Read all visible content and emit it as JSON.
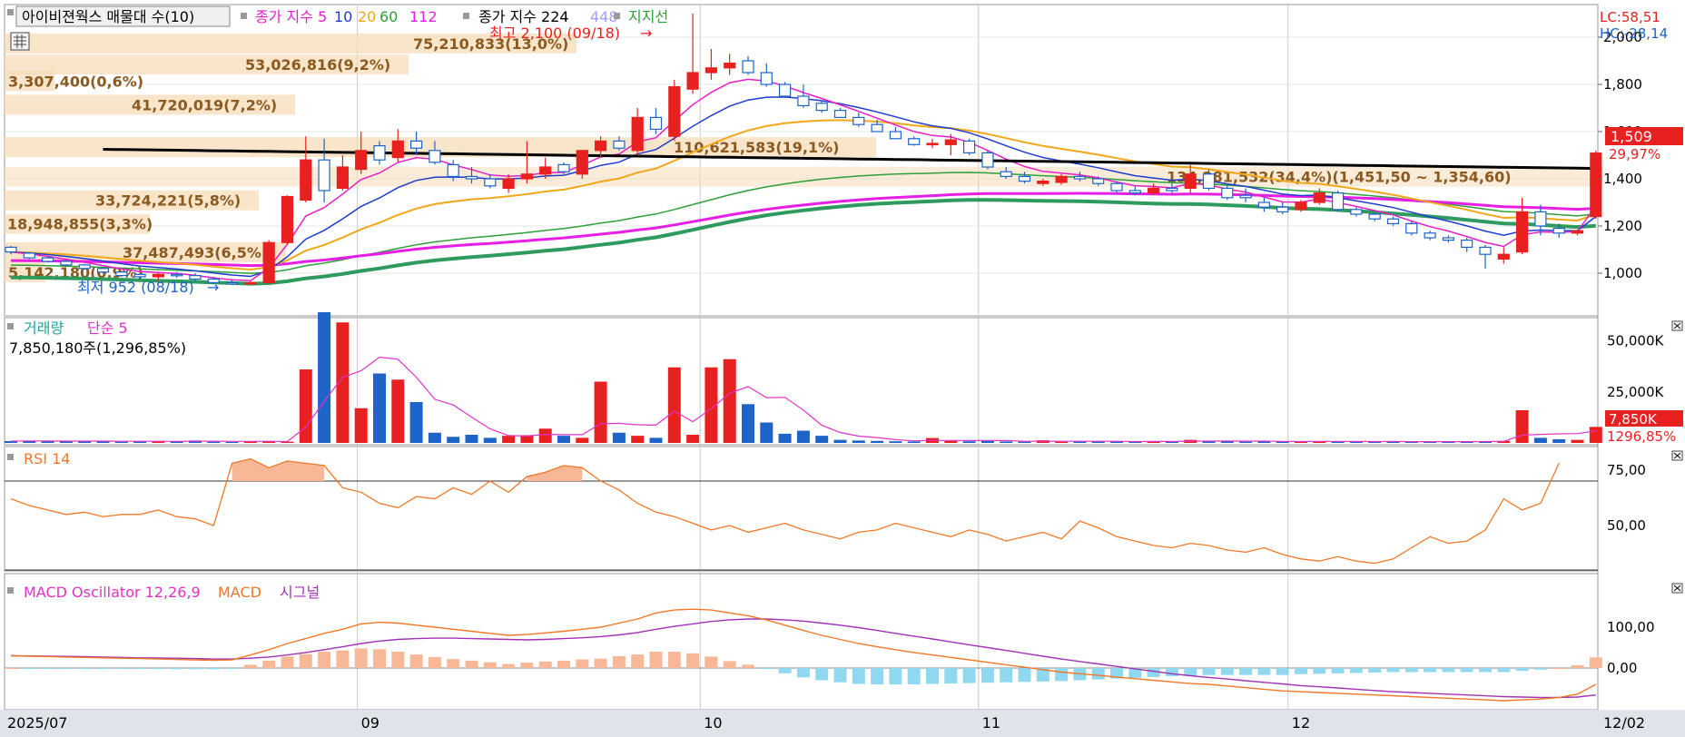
{
  "colors": {
    "up": "#e8201f",
    "down": "#1e63c8",
    "ma5": "#e61ec8",
    "ma10": "#1e3ccd",
    "ma20": "#f0a81a",
    "ma60": "#2ea03a",
    "ma112": "#e61ee6",
    "ma224": "#000000",
    "ma448": "#2f9a5e",
    "vol_ma": "#e032c8",
    "rsi": "#f07828",
    "macd": "#f07828",
    "signal": "#a032b4",
    "osc_pos": "#f8b898",
    "osc_neg": "#8fd8f0",
    "profile": "#f5dcb8",
    "profile_text": "#8a5a20",
    "grid": "#c8c8c8"
  },
  "header": {
    "title": "아이비젼웍스 매물대 수(10)",
    "ma_label": "종가 지수",
    "ma_periods": [
      "5",
      "10",
      "20",
      "60",
      "112"
    ],
    "ma_long_label": "종가 지수 224",
    "ma_long_extra": "448",
    "support_label": "지지선"
  },
  "price_panel": {
    "lc": "LC:58,51",
    "hc": "HC:-28,14",
    "axis_ticks": [
      "2,000",
      "1,800",
      "1,600",
      "1,400",
      "1,200",
      "1,000"
    ],
    "current_price": "1,509",
    "current_change": "29,97%",
    "high_label": "최고 2,100 (09/18)",
    "low_label": "최저 952 (08/18)",
    "volume_profile": [
      {
        "label": "75,210,833(13,0%)",
        "price": 1970
      },
      {
        "label": "53,026,816(9,2%)",
        "price": 1880
      },
      {
        "label": "3,307,400(0,6%)",
        "price": 1810
      },
      {
        "label": "41,720,019(7,2%)",
        "price": 1710
      },
      {
        "label": "110,621,583(19,1%)",
        "price": 1530
      },
      {
        "label": "134,281,532(34,4%)(1,451,50 ~ 1,354,60)",
        "price": 1405
      },
      {
        "label": "33,724,221(5,8%)",
        "price": 1305
      },
      {
        "label": "18,948,855(3,3%)",
        "price": 1205
      },
      {
        "label": "37,487,493(6,5%)",
        "price": 1085
      },
      {
        "label": "5,142,180(0,9%)",
        "price": 1000
      }
    ]
  },
  "volume_panel": {
    "title": "거래량",
    "ma_label": "단순 5",
    "info": "7,850,180주(1,296,85%)",
    "axis_ticks": [
      "50,000K",
      "25,000K"
    ],
    "current_value": "7,850K",
    "current_pct": "1296,85%"
  },
  "rsi_panel": {
    "title": "RSI 14",
    "axis_ticks": [
      "75,00",
      "50,00"
    ]
  },
  "macd_panel": {
    "title": "MACD Oscillator 12,26,9",
    "macd_label": "MACD",
    "signal_label": "시그널",
    "axis_ticks": [
      "100,00",
      "0,00"
    ]
  },
  "x_axis": {
    "ticks": [
      "2025/07",
      "09",
      "10",
      "11",
      "12",
      "12/02"
    ]
  },
  "chart_data": {
    "type": "candlestick",
    "title": "아이비젼웍스 매물대 수(10)",
    "ylim": [
      860,
      2020
    ],
    "candles": [
      [
        1110,
        1115,
        1080,
        1090
      ],
      [
        1085,
        1090,
        1060,
        1065
      ],
      [
        1065,
        1070,
        1045,
        1050
      ],
      [
        1050,
        1055,
        1030,
        1035
      ],
      [
        1035,
        1040,
        1015,
        1020
      ],
      [
        1020,
        1025,
        1000,
        1005
      ],
      [
        1005,
        1010,
        985,
        990
      ],
      [
        995,
        1000,
        975,
        985
      ],
      [
        985,
        1000,
        970,
        995
      ],
      [
        995,
        1005,
        980,
        990
      ],
      [
        990,
        1000,
        965,
        975
      ],
      [
        975,
        985,
        955,
        960
      ],
      [
        960,
        970,
        952,
        955
      ],
      [
        955,
        965,
        952,
        960
      ],
      [
        960,
        1140,
        955,
        1130
      ],
      [
        1130,
        1330,
        1120,
        1325
      ],
      [
        1310,
        1580,
        1300,
        1480
      ],
      [
        1480,
        1570,
        1300,
        1350
      ],
      [
        1360,
        1500,
        1350,
        1450
      ],
      [
        1440,
        1600,
        1420,
        1520
      ],
      [
        1540,
        1560,
        1460,
        1480
      ],
      [
        1490,
        1610,
        1470,
        1560
      ],
      [
        1560,
        1600,
        1500,
        1530
      ],
      [
        1520,
        1560,
        1460,
        1470
      ],
      [
        1460,
        1480,
        1390,
        1410
      ],
      [
        1410,
        1450,
        1380,
        1400
      ],
      [
        1400,
        1420,
        1360,
        1370
      ],
      [
        1360,
        1420,
        1340,
        1400
      ],
      [
        1400,
        1560,
        1380,
        1420
      ],
      [
        1420,
        1490,
        1400,
        1450
      ],
      [
        1460,
        1470,
        1420,
        1430
      ],
      [
        1420,
        1510,
        1400,
        1520
      ],
      [
        1520,
        1580,
        1490,
        1560
      ],
      [
        1560,
        1580,
        1520,
        1530
      ],
      [
        1520,
        1700,
        1500,
        1660
      ],
      [
        1660,
        1700,
        1590,
        1610
      ],
      [
        1580,
        1820,
        1560,
        1790
      ],
      [
        1780,
        2100,
        1760,
        1850
      ],
      [
        1850,
        1950,
        1820,
        1870
      ],
      [
        1870,
        1930,
        1840,
        1890
      ],
      [
        1900,
        1920,
        1840,
        1850
      ],
      [
        1850,
        1890,
        1790,
        1800
      ],
      [
        1800,
        1810,
        1750,
        1750
      ],
      [
        1750,
        1800,
        1700,
        1710
      ],
      [
        1720,
        1730,
        1680,
        1690
      ],
      [
        1690,
        1700,
        1660,
        1660
      ],
      [
        1660,
        1680,
        1620,
        1630
      ],
      [
        1630,
        1650,
        1600,
        1600
      ],
      [
        1600,
        1620,
        1570,
        1570
      ],
      [
        1570,
        1580,
        1540,
        1545
      ],
      [
        1545,
        1570,
        1530,
        1550
      ],
      [
        1545,
        1590,
        1500,
        1565
      ],
      [
        1560,
        1570,
        1500,
        1510
      ],
      [
        1510,
        1520,
        1440,
        1450
      ],
      [
        1430,
        1450,
        1400,
        1410
      ],
      [
        1410,
        1430,
        1380,
        1390
      ],
      [
        1380,
        1400,
        1370,
        1390
      ],
      [
        1385,
        1420,
        1375,
        1410
      ],
      [
        1410,
        1430,
        1390,
        1400
      ],
      [
        1400,
        1410,
        1370,
        1380
      ],
      [
        1380,
        1390,
        1340,
        1350
      ],
      [
        1350,
        1370,
        1330,
        1340
      ],
      [
        1340,
        1380,
        1330,
        1360
      ],
      [
        1360,
        1380,
        1340,
        1350
      ],
      [
        1360,
        1460,
        1340,
        1420
      ],
      [
        1420,
        1440,
        1350,
        1360
      ],
      [
        1360,
        1380,
        1310,
        1320
      ],
      [
        1330,
        1360,
        1300,
        1320
      ],
      [
        1300,
        1320,
        1260,
        1280
      ],
      [
        1280,
        1300,
        1250,
        1260
      ],
      [
        1270,
        1310,
        1260,
        1300
      ],
      [
        1300,
        1360,
        1290,
        1340
      ],
      [
        1340,
        1350,
        1260,
        1270
      ],
      [
        1270,
        1280,
        1240,
        1250
      ],
      [
        1250,
        1260,
        1220,
        1230
      ],
      [
        1230,
        1240,
        1200,
        1210
      ],
      [
        1210,
        1220,
        1160,
        1170
      ],
      [
        1170,
        1180,
        1140,
        1150
      ],
      [
        1150,
        1160,
        1130,
        1140
      ],
      [
        1140,
        1150,
        1090,
        1110
      ],
      [
        1110,
        1120,
        1020,
        1080
      ],
      [
        1060,
        1110,
        1040,
        1080
      ],
      [
        1090,
        1320,
        1080,
        1260
      ],
      [
        1260,
        1290,
        1160,
        1200
      ],
      [
        1190,
        1210,
        1150,
        1170
      ],
      [
        1170,
        1180,
        1160,
        1180
      ],
      [
        1240,
        1520,
        1230,
        1509
      ]
    ],
    "volume_k": [
      900,
      1100,
      800,
      700,
      1000,
      800,
      600,
      900,
      700,
      800,
      1200,
      600,
      500,
      700,
      900,
      600,
      36000,
      64000,
      59000,
      17000,
      34000,
      31000,
      20000,
      5000,
      3000,
      4000,
      2500,
      3500,
      3800,
      7000,
      3500,
      2500,
      30000,
      5000,
      3500,
      2500,
      37000,
      4000,
      37000,
      41000,
      19000,
      10000,
      4500,
      6000,
      3500,
      1500,
      1200,
      1000,
      800,
      700,
      2400,
      1000,
      800,
      900,
      700,
      600,
      1300,
      600,
      700,
      800,
      700,
      600,
      700,
      800,
      1500,
      900,
      700,
      600,
      700,
      800,
      600,
      900,
      700,
      600,
      500,
      800,
      600,
      500,
      700,
      600,
      900,
      1000,
      16000,
      2500,
      1800,
      1500,
      7850
    ],
    "rsi": [
      62,
      59,
      57,
      55,
      56,
      54,
      55,
      55,
      57,
      54,
      53,
      50,
      78,
      80,
      76,
      79,
      78,
      77,
      67,
      65,
      60,
      58,
      63,
      62,
      67,
      64,
      70,
      65,
      72,
      74,
      77,
      76,
      70,
      66,
      60,
      56,
      54,
      51,
      48,
      50,
      47,
      49,
      51,
      48,
      46,
      44,
      47,
      48,
      51,
      49,
      47,
      45,
      48,
      46,
      43,
      45,
      47,
      44,
      52,
      49,
      45,
      43,
      41,
      40,
      42,
      41,
      39,
      38,
      40,
      37,
      35,
      34,
      36,
      34,
      33,
      35,
      40,
      45,
      42,
      43,
      48,
      62,
      57,
      60,
      78
    ],
    "macd": [
      30,
      29,
      28,
      27,
      26,
      25,
      24,
      23,
      22,
      21,
      20,
      19,
      20,
      32,
      45,
      60,
      72,
      85,
      95,
      108,
      112,
      110,
      105,
      100,
      95,
      90,
      85,
      80,
      82,
      86,
      90,
      95,
      100,
      110,
      120,
      135,
      142,
      144,
      142,
      135,
      128,
      118,
      105,
      92,
      80,
      70,
      60,
      52,
      45,
      38,
      32,
      26,
      20,
      14,
      8,
      2,
      -4,
      -10,
      -14,
      -18,
      -22,
      -26,
      -30,
      -34,
      -38,
      -40,
      -44,
      -48,
      -52,
      -56,
      -58,
      -60,
      -62,
      -64,
      -66,
      -68,
      -70,
      -72,
      -74,
      -76,
      -78,
      -80,
      -78,
      -76,
      -72,
      -64,
      -40
    ],
    "signal": [
      30,
      29.5,
      29,
      28.5,
      28,
      27,
      26,
      25,
      24.5,
      24,
      23,
      22,
      22,
      24,
      27,
      32,
      38,
      45,
      52,
      60,
      66,
      70,
      72,
      73,
      73,
      72,
      71,
      70,
      69,
      70,
      72,
      74,
      77,
      81,
      87,
      95,
      102,
      108,
      114,
      118,
      120,
      120,
      118,
      115,
      110,
      105,
      99,
      92,
      85,
      78,
      71,
      64,
      57,
      50,
      43,
      36,
      29,
      22,
      16,
      10,
      4,
      -2,
      -8,
      -14,
      -19,
      -23,
      -27,
      -31,
      -35,
      -39,
      -43,
      -46,
      -49,
      -52,
      -55,
      -58,
      -60,
      -62,
      -64,
      -66,
      -68,
      -70,
      -71,
      -72,
      -72,
      -71,
      -66
    ]
  }
}
